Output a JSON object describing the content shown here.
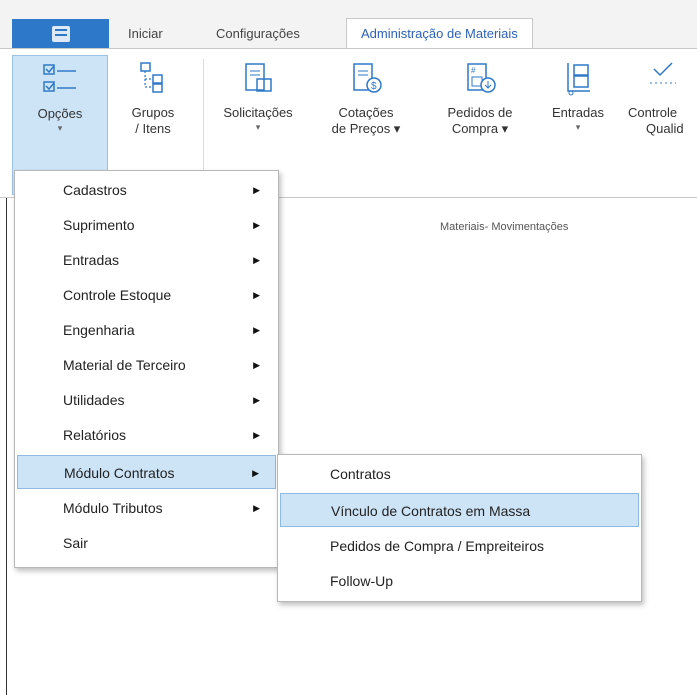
{
  "tabs": [
    {
      "label": "Iniciar"
    },
    {
      "label": "Configurações"
    },
    {
      "label": "Administração de Materiais"
    }
  ],
  "ribbon": {
    "buttons": [
      {
        "label1": "Opções",
        "label2": "",
        "dropdown": "▾",
        "icon": "checklist-icon"
      },
      {
        "label1": "Grupos",
        "label2": "/ Itens",
        "dropdown": "",
        "icon": "tree-icon"
      },
      {
        "label1": "Solicitações",
        "label2": "",
        "dropdown": "▾",
        "icon": "request-icon"
      },
      {
        "label1": "Cotações",
        "label2": "de Preços ▾",
        "dropdown": "",
        "icon": "quote-icon"
      },
      {
        "label1": "Pedidos de",
        "label2": "Compra ▾",
        "dropdown": "",
        "icon": "purchase-order-icon"
      },
      {
        "label1": "Entradas",
        "label2": "",
        "dropdown": "▾",
        "icon": "cart-icon"
      },
      {
        "label1": "Controle",
        "label2": "Qualid",
        "dropdown": "",
        "icon": "quality-icon"
      }
    ],
    "group_label": "Materiais- Movimentações"
  },
  "menu": {
    "items": [
      {
        "label": "Cadastros",
        "arrow": "▶"
      },
      {
        "label": "Suprimento",
        "arrow": "▶"
      },
      {
        "label": "Entradas",
        "arrow": "▶"
      },
      {
        "label": "Controle Estoque",
        "arrow": "▶"
      },
      {
        "label": "Engenharia",
        "arrow": "▶"
      },
      {
        "label": "Material de Terceiro",
        "arrow": "▶"
      },
      {
        "label": "Utilidades",
        "arrow": "▶"
      },
      {
        "label": "Relatórios",
        "arrow": "▶"
      },
      {
        "label": "Módulo Contratos",
        "arrow": "▶"
      },
      {
        "label": "Módulo Tributos",
        "arrow": "▶"
      },
      {
        "label": "Sair",
        "arrow": ""
      }
    ]
  },
  "submenu": {
    "items": [
      {
        "label": "Contratos"
      },
      {
        "label": "Vínculo de Contratos em Massa"
      },
      {
        "label": "Pedidos de Compra / Empreiteiros"
      },
      {
        "label": "Follow-Up"
      }
    ]
  },
  "colors": {
    "accent": "#2d78c8",
    "highlight": "#cde4f7",
    "icon": "#2e79c7"
  }
}
